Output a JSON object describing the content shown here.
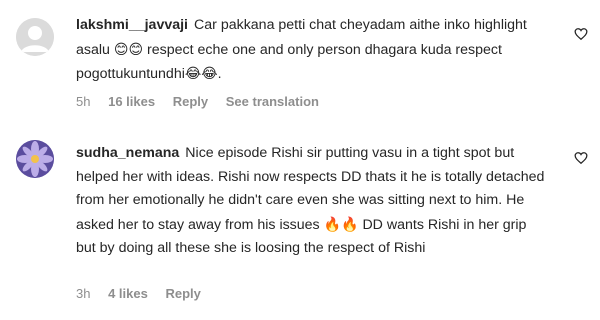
{
  "comments": [
    {
      "username": "lakshmi__javvaji",
      "text_part1": "Car pakkana petti chat cheyadam aithe inko highlight asalu",
      "emoji1": "😊😊",
      "text_part2": "respect eche one and only person dhagara kuda respect pogottukuntundhi",
      "emoji2": "😂😂",
      "text_part3": ".",
      "time": "5h",
      "likes": "16 likes",
      "reply_label": "Reply",
      "translation_label": "See translation",
      "avatar_icon": "default-avatar-icon",
      "like_icon": "heart-outline-icon"
    },
    {
      "username": "sudha_nemana",
      "text_part1": "Nice episode Rishi sir putting vasu in a tight spot but helped her with ideas. Rishi now respects DD thats it he is totally detached from her emotionally he didn't care even she was sitting next to him. He asked her to stay away from his issues",
      "emoji1": "🔥🔥",
      "text_part2": "DD wants Rishi in her grip but by doing all these she is loosing the respect of Rishi",
      "time": "3h",
      "likes": "4 likes",
      "reply_label": "Reply",
      "avatar_icon": "flower-avatar-icon",
      "like_icon": "heart-outline-icon"
    }
  ]
}
